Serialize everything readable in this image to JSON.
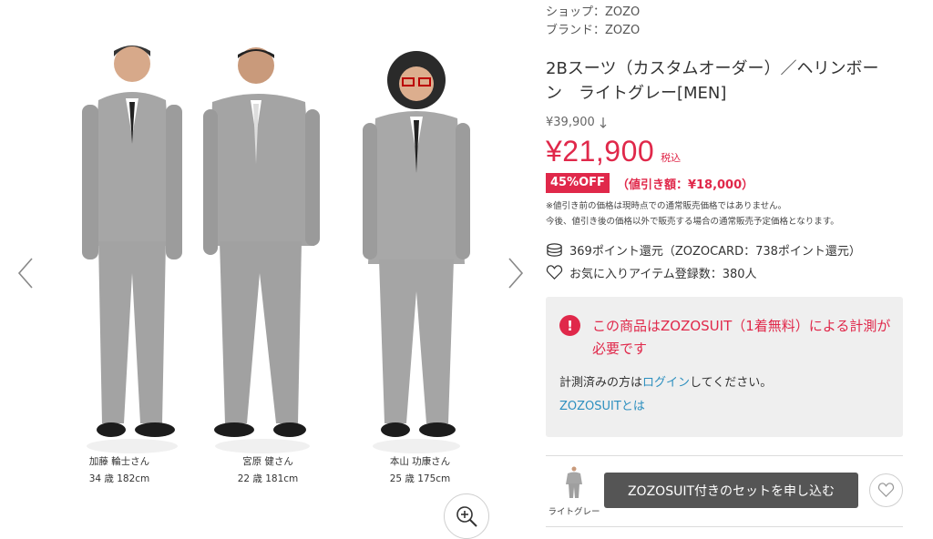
{
  "gallery": {
    "models": [
      {
        "name": "加藤 輪士さん",
        "details": "34 歳 182cm"
      },
      {
        "name": "宮原 健さん",
        "details": "22 歳 181cm"
      },
      {
        "name": "本山 功康さん",
        "details": "25 歳 175cm"
      }
    ],
    "icons": {
      "prev": "chevron-left-icon",
      "next": "chevron-right-icon",
      "zoom": "zoom-in-icon"
    }
  },
  "product": {
    "shop": "ショップ：ZOZO",
    "brand": "ブランド：ZOZO",
    "title": "2Bスーツ（カスタムオーダー）／ヘリンボーン　ライトグレー[MEN]",
    "original_price": "¥39,900",
    "price": "¥21,900",
    "tax_label": "税込",
    "discount_badge": "45%OFF",
    "discount_amount": "（値引き額：¥18,000）",
    "note_line1": "※値引き前の価格は現時点での通常販売価格ではありません。",
    "note_line2": "今後、値引き後の価格以外で販売する場合の通常販売予定価格となります。",
    "points": "369ポイント還元（ZOZOCARD：738ポイント還元）",
    "favorites": "お気に入りアイテム登録数：380人"
  },
  "alert": {
    "icon_text": "!",
    "message": "この商品はZOZOSUIT（1着無料）による計測が必要です",
    "login_prefix": "計測済みの方は",
    "login_link": "ログイン",
    "login_suffix": "してください。",
    "suit_link": "ZOZOSUITとは"
  },
  "purchase": {
    "variant_label": "ライトグレー",
    "button_label": "ZOZOSUIT付きのセットを申し込む"
  },
  "colors": {
    "accent": "#e0284a",
    "link": "#2c8fbf",
    "button": "#555555",
    "suit": "#a6a6a6"
  }
}
